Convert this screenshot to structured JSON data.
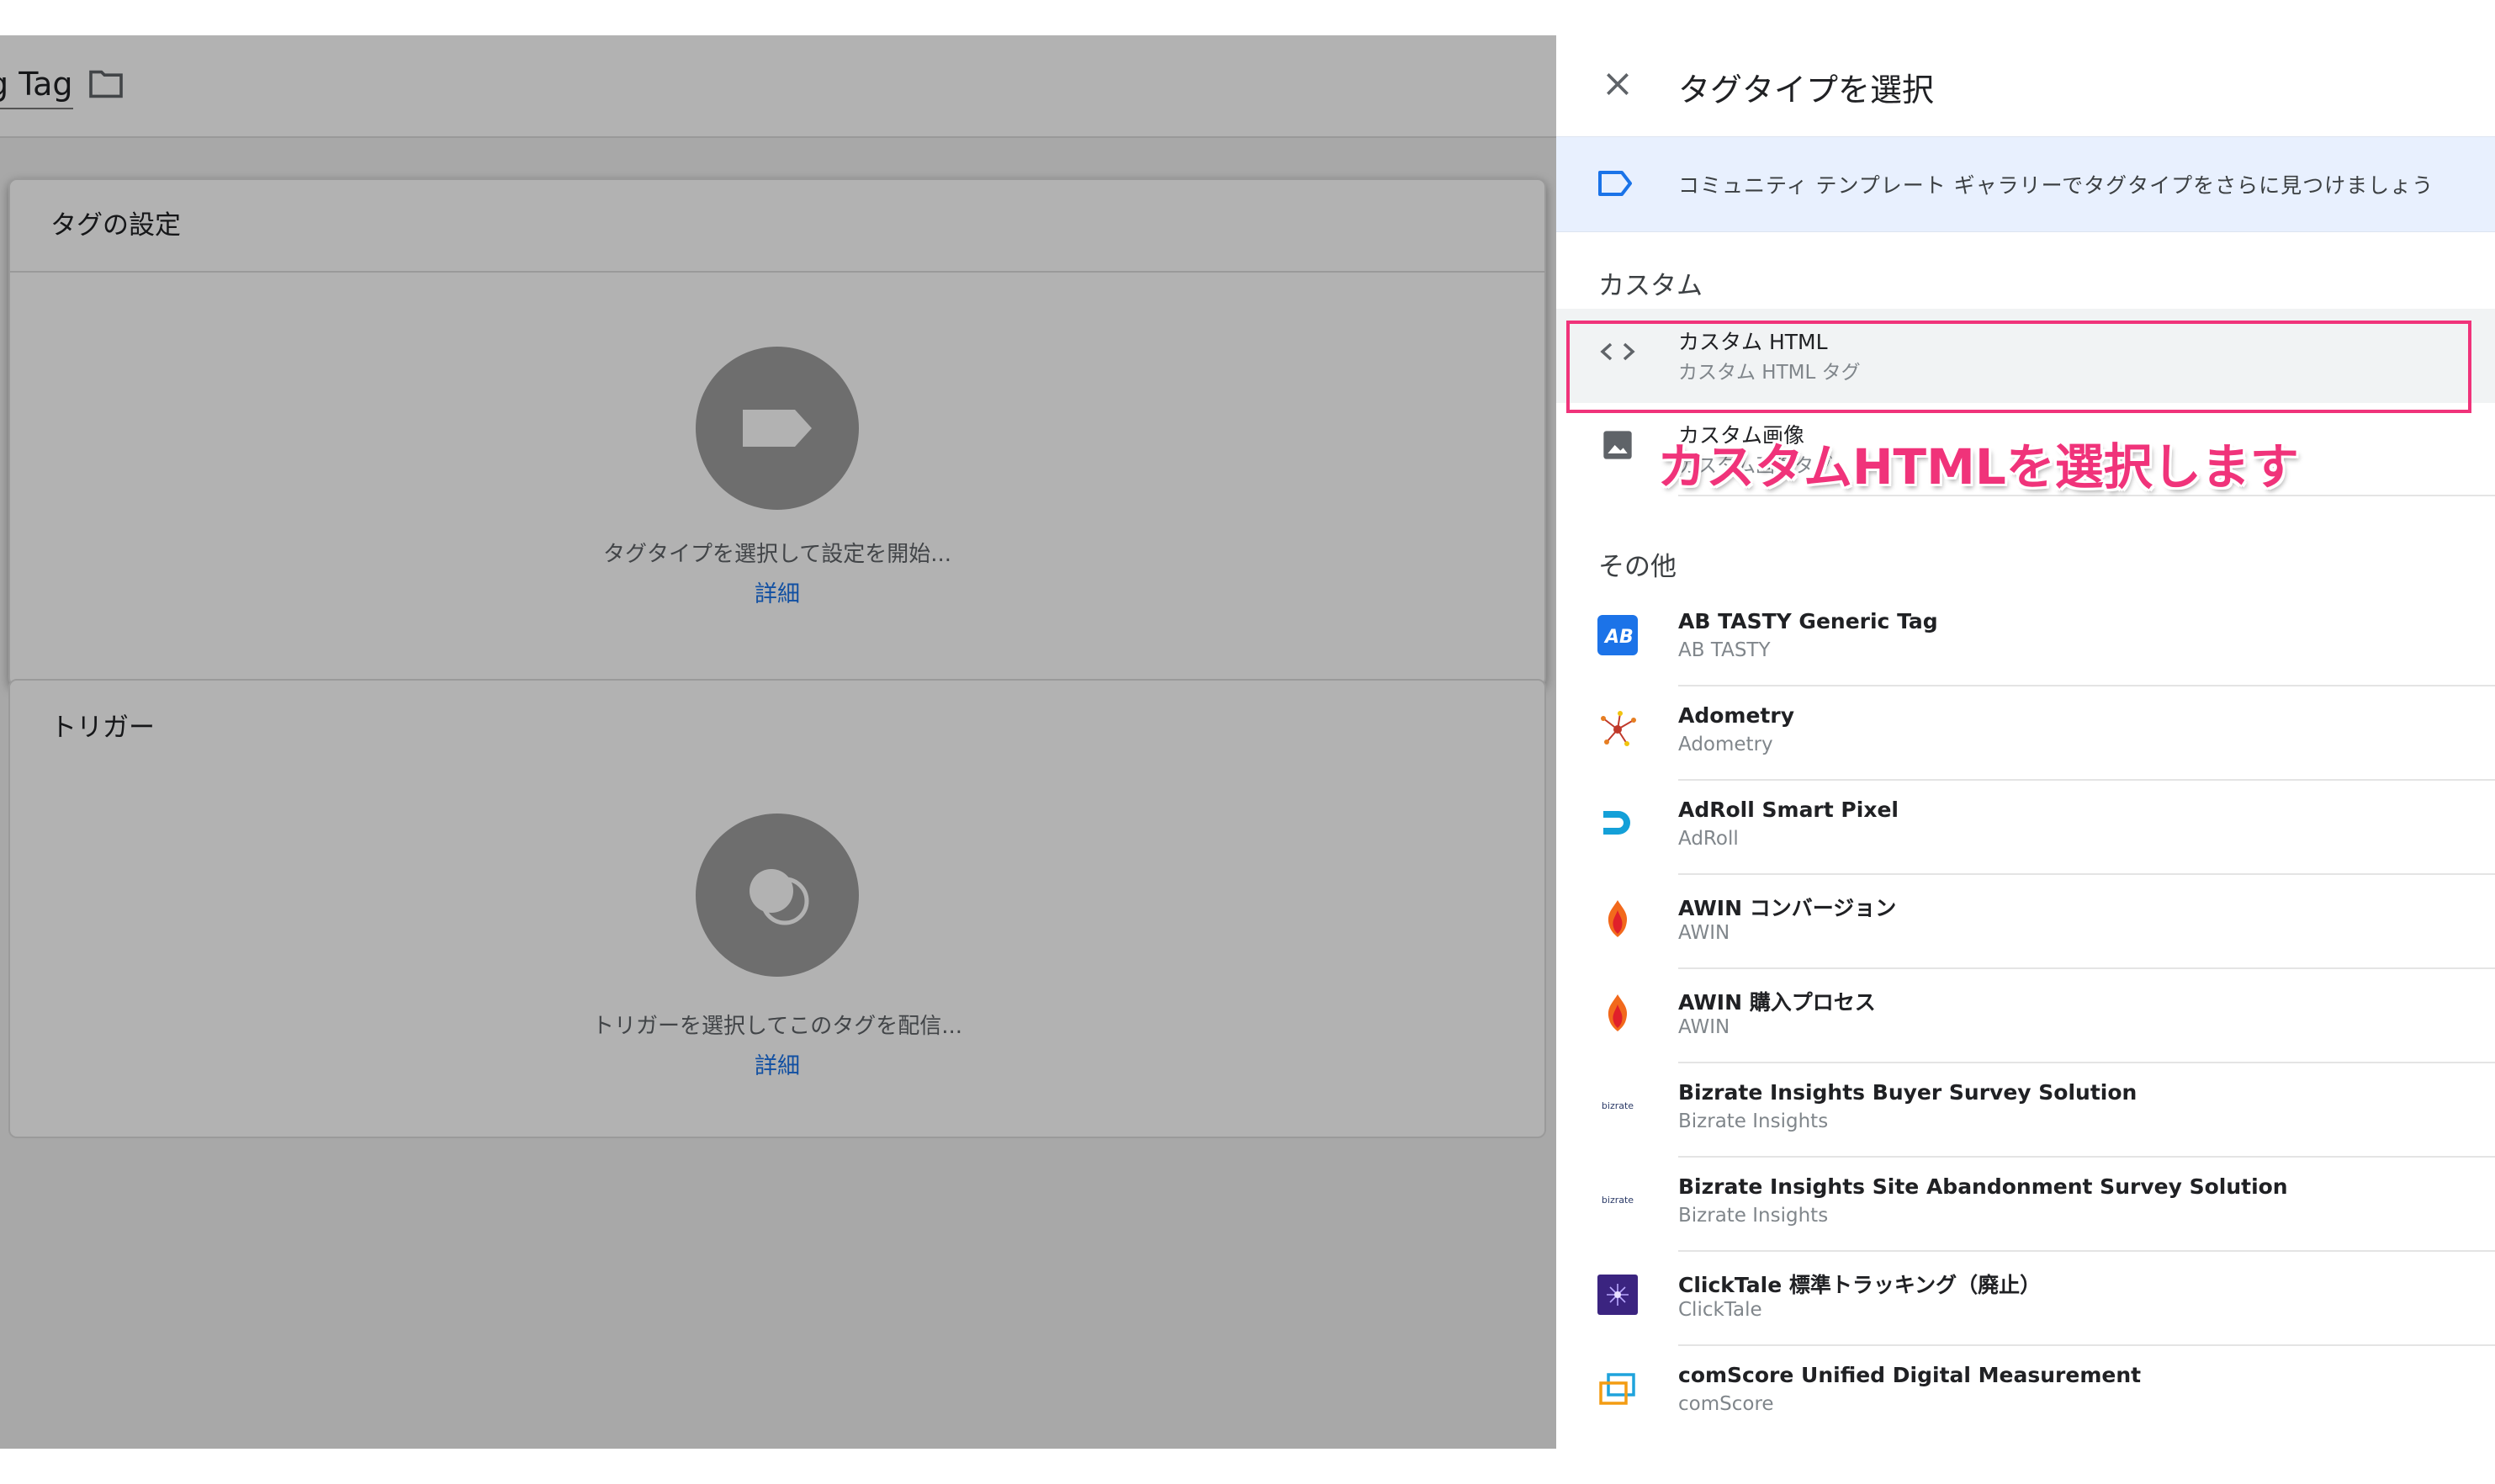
{
  "editor": {
    "tag_name_fragment": "g Tag",
    "tag_config": {
      "title": "タグの設定",
      "hint": "タグタイプを選択して設定を開始...",
      "link": "詳細"
    },
    "trigger": {
      "title": "トリガー",
      "hint": "トリガーを選択してこのタグを配信...",
      "link": "詳細"
    }
  },
  "panel": {
    "title": "タグタイプを選択",
    "banner_text": "コミュニティ テンプレート ギャラリーでタグタイプをさらに見つけましょう",
    "custom_section": "カスタム",
    "custom_items": [
      {
        "title": "カスタム HTML",
        "subtitle": "カスタム HTML タグ",
        "icon": "code-icon"
      },
      {
        "title": "カスタム画像",
        "subtitle": "カスタム画像タグ",
        "icon": "image-icon"
      }
    ],
    "other_section": "その他",
    "other_items": [
      {
        "title": "AB TASTY Generic Tag",
        "subtitle": "AB TASTY",
        "icon": "abtasty-logo-icon"
      },
      {
        "title": "Adometry",
        "subtitle": "Adometry",
        "icon": "adometry-logo-icon"
      },
      {
        "title": "AdRoll Smart Pixel",
        "subtitle": "AdRoll",
        "icon": "adroll-logo-icon"
      },
      {
        "title": "AWIN コンバージョン",
        "subtitle": "AWIN",
        "icon": "awin-logo-icon"
      },
      {
        "title": "AWIN 購入プロセス",
        "subtitle": "AWIN",
        "icon": "awin-logo-icon"
      },
      {
        "title": "Bizrate Insights Buyer Survey Solution",
        "subtitle": "Bizrate Insights",
        "icon": "bizrate-logo-icon"
      },
      {
        "title": "Bizrate Insights Site Abandonment Survey Solution",
        "subtitle": "Bizrate Insights",
        "icon": "bizrate-logo-icon"
      },
      {
        "title": "ClickTale 標準トラッキング（廃止）",
        "subtitle": "ClickTale",
        "icon": "clicktale-logo-icon"
      },
      {
        "title": "comScore Unified Digital Measurement",
        "subtitle": "comScore",
        "icon": "comscore-logo-icon"
      }
    ],
    "bizrate_logo_text": "bizrate"
  },
  "annotation": "カスタムHTMLを選択します",
  "colors": {
    "accent_link": "#1a73e8",
    "highlight": "#f0337a",
    "banner_bg": "#e8f0fe"
  }
}
